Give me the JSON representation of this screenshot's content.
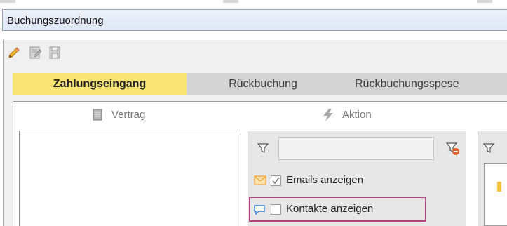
{
  "window": {
    "title": "Buchungszuordnung"
  },
  "toolbar": {
    "icons": [
      "pencil-icon",
      "edit-document-icon",
      "save-icon"
    ]
  },
  "tabs": [
    {
      "label": "Zahlungseingang",
      "active": true
    },
    {
      "label": "Rückbuchung",
      "active": false
    },
    {
      "label": "Rückbuchungsspese",
      "active": false
    }
  ],
  "sections": {
    "vertrag": "Vertrag",
    "aktion": "Aktion"
  },
  "filter": {
    "value": "",
    "emails_label": "Emails anzeigen",
    "emails_checked": true,
    "kontakte_label": "Kontakte anzeigen",
    "kontakte_checked": false
  },
  "colors": {
    "active_tab": "#f7e472",
    "highlight": "#b4417f",
    "mail": "#f0a030",
    "chat": "#2f7fcf"
  }
}
